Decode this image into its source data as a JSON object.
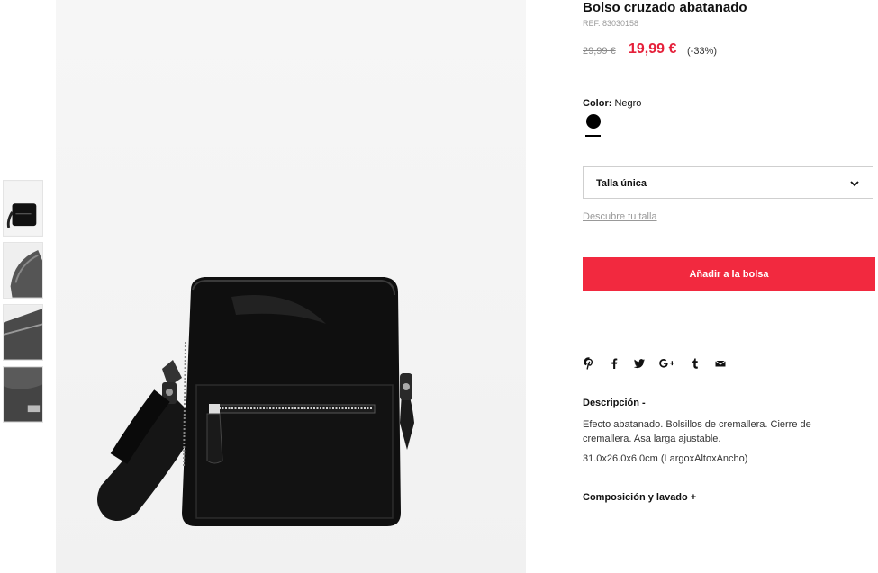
{
  "product": {
    "title": "Bolso cruzado abatanado",
    "ref": "REF. 83030158",
    "old_price": "29,99 €",
    "new_price": "19,99 €",
    "discount": "(-33%)",
    "price_color": "#e5203a"
  },
  "color": {
    "label": "Color:",
    "value": "Negro",
    "swatch_hex": "#000000"
  },
  "size": {
    "selected": "Talla única",
    "icon": "chevron-down-icon",
    "help_link": "Descubre tu talla"
  },
  "cart": {
    "add_label": "Añadir a la bolsa",
    "button_color": "#f2293f"
  },
  "share": {
    "icons": [
      "pinterest-icon",
      "facebook-icon",
      "twitter-icon",
      "google-plus-icon",
      "tumblr-icon",
      "email-icon"
    ]
  },
  "description": {
    "title": "Descripción  -",
    "text": "Efecto abatanado. Bolsillos de cremallera. Cierre de cremallera. Asa larga ajustable.",
    "dimensions": "31.0x26.0x6.0cm (LargoxAltoxAncho)"
  },
  "composition": {
    "title": "Composición y lavado  +"
  }
}
